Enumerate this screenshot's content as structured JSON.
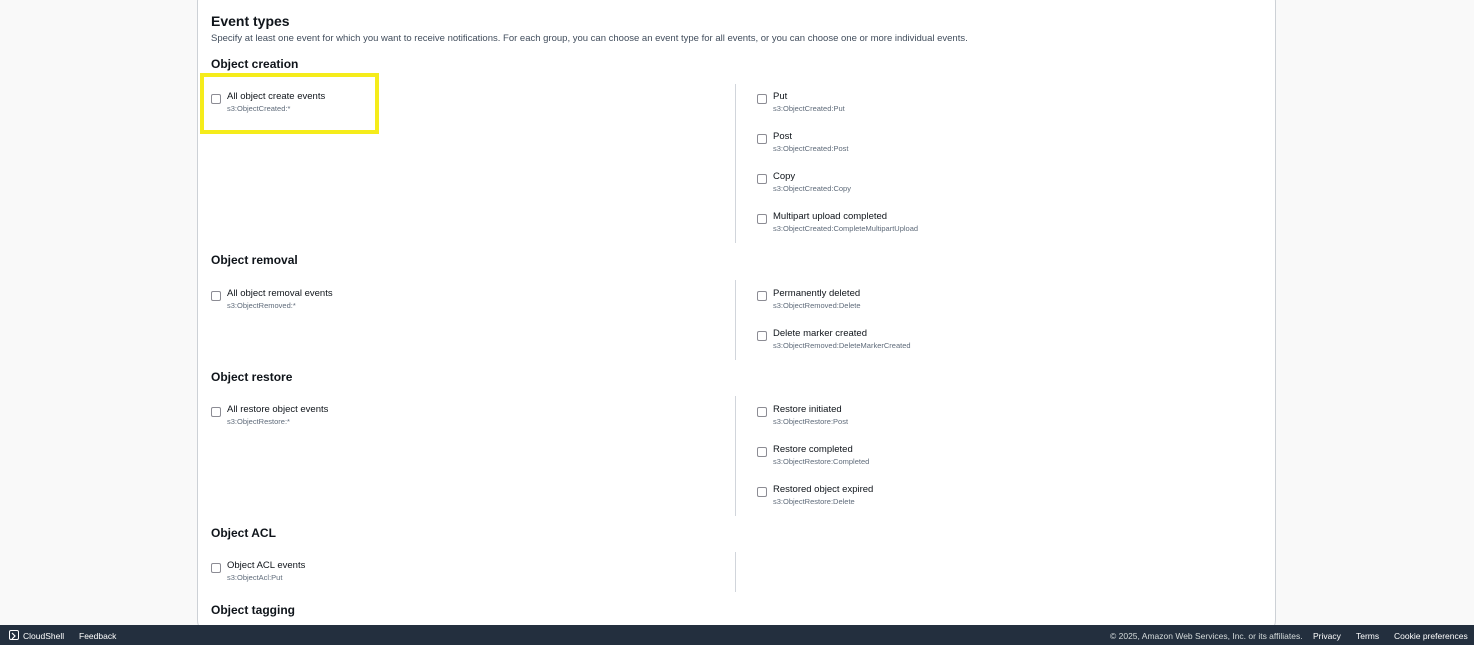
{
  "panel": {
    "title": "Event types",
    "description": "Specify at least one event for which you want to receive notifications. For each group, you can choose an event type for all events, or you can choose one or more individual events."
  },
  "groups": [
    {
      "title": "Object creation",
      "all": {
        "label": "All object create events",
        "code": "s3:ObjectCreated:*"
      },
      "items": [
        {
          "label": "Put",
          "code": "s3:ObjectCreated:Put"
        },
        {
          "label": "Post",
          "code": "s3:ObjectCreated:Post"
        },
        {
          "label": "Copy",
          "code": "s3:ObjectCreated:Copy"
        },
        {
          "label": "Multipart upload completed",
          "code": "s3:ObjectCreated:CompleteMultipartUpload"
        }
      ]
    },
    {
      "title": "Object removal",
      "all": {
        "label": "All object removal events",
        "code": "s3:ObjectRemoved:*"
      },
      "items": [
        {
          "label": "Permanently deleted",
          "code": "s3:ObjectRemoved:Delete"
        },
        {
          "label": "Delete marker created",
          "code": "s3:ObjectRemoved:DeleteMarkerCreated"
        }
      ]
    },
    {
      "title": "Object restore",
      "all": {
        "label": "All restore object events",
        "code": "s3:ObjectRestore:*"
      },
      "items": [
        {
          "label": "Restore initiated",
          "code": "s3:ObjectRestore:Post"
        },
        {
          "label": "Restore completed",
          "code": "s3:ObjectRestore:Completed"
        },
        {
          "label": "Restored object expired",
          "code": "s3:ObjectRestore:Delete"
        }
      ]
    },
    {
      "title": "Object ACL",
      "all": {
        "label": "Object ACL events",
        "code": "s3:ObjectAcl:Put"
      },
      "items": []
    },
    {
      "title": "Object tagging"
    }
  ],
  "footer": {
    "cloudshell": "CloudShell",
    "feedback": "Feedback",
    "copyright": "© 2025, Amazon Web Services, Inc. or its affiliates.",
    "privacy": "Privacy",
    "terms": "Terms",
    "cookie": "Cookie preferences"
  },
  "colors": {
    "highlight": "#f5ec1b",
    "footer_bg": "#232f3e"
  }
}
